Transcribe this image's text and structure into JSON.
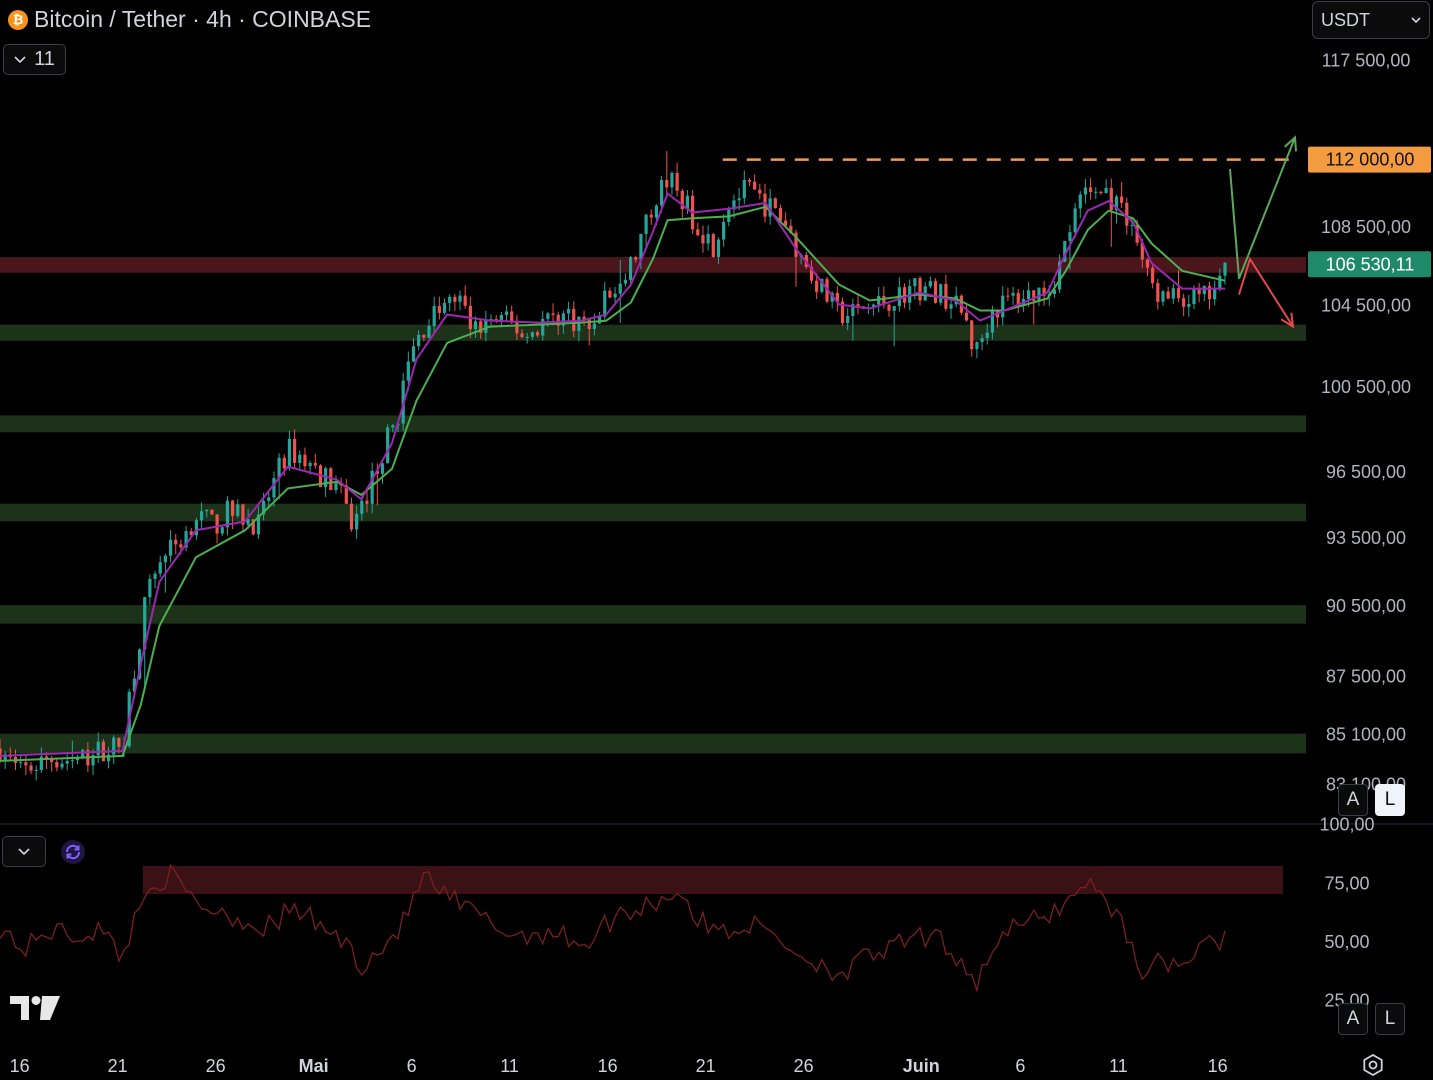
{
  "header": {
    "title": "Bitcoin / Tether · 4h · COINBASE",
    "coin_glyph": "₿",
    "indicators_count": "11"
  },
  "currency": {
    "selected": "USDT"
  },
  "scale_buttons": {
    "auto": "A",
    "log": "L"
  },
  "colors": {
    "up": "#26a69a",
    "down": "#ef5350",
    "ema_fast": "#9c27b0",
    "ema_slow": "#4caf50",
    "support_zone": "#1c3219",
    "resistance_zone": "#4a151b",
    "resistance_line": "#f59b3f",
    "rsi_line": "#7a1f22",
    "rsi_zone": "#3a1215",
    "last_price_bg": "#1f8a6a",
    "target_arrow": "#5aa95a",
    "drop_arrow": "#e04a4a"
  },
  "chart_data": [
    {
      "type": "candlestick",
      "title": "Bitcoin / Tether · 4h · COINBASE",
      "timeframe": "4h",
      "x_tick_labels": [
        "16",
        "21",
        "26",
        "Mai",
        "6",
        "11",
        "16",
        "21",
        "26",
        "Juin",
        "6",
        "11",
        "16"
      ],
      "y_tick_labels": [
        "117 500,00",
        "108 500,00",
        "104 500,00",
        "100 500,00",
        "96 500,00",
        "93 500,00",
        "90 500,00",
        "87 500,00",
        "85 100,00",
        "83 100,00"
      ],
      "y_range": [
        82600,
        118600
      ],
      "price_path": [
        [
          0,
          84500
        ],
        [
          1.6,
          83500
        ],
        [
          4,
          84100
        ],
        [
          6.5,
          84000
        ],
        [
          8.5,
          84500
        ],
        [
          10,
          84600
        ],
        [
          10.5,
          86500
        ],
        [
          11.2,
          88500
        ],
        [
          12,
          91000
        ],
        [
          13,
          92500
        ],
        [
          15,
          93500
        ],
        [
          16,
          94500
        ],
        [
          17.5,
          94000
        ],
        [
          18.6,
          94600
        ],
        [
          20,
          94400
        ],
        [
          21.2,
          94000
        ],
        [
          22,
          95500
        ],
        [
          23.5,
          97500
        ],
        [
          24.5,
          97200
        ],
        [
          26,
          96400
        ],
        [
          27.5,
          95800
        ],
        [
          28.8,
          94000
        ],
        [
          30,
          95500
        ],
        [
          31.5,
          97800
        ],
        [
          32.4,
          99000
        ],
        [
          33.5,
          102000
        ],
        [
          35,
          103800
        ],
        [
          36.5,
          104500
        ],
        [
          37.5,
          104800
        ],
        [
          38.6,
          103200
        ],
        [
          40,
          103700
        ],
        [
          41.5,
          103600
        ],
        [
          43,
          102900
        ],
        [
          44.5,
          103800
        ],
        [
          46,
          104000
        ],
        [
          47.5,
          103600
        ],
        [
          48.5,
          103200
        ],
        [
          49.2,
          104800
        ],
        [
          50,
          105000
        ],
        [
          50.8,
          105500
        ],
        [
          52,
          107200
        ],
        [
          53.2,
          109300
        ],
        [
          54,
          111200
        ],
        [
          55,
          110700
        ],
        [
          56.5,
          109000
        ],
        [
          58.2,
          107500
        ],
        [
          59.5,
          109800
        ],
        [
          61,
          110400
        ],
        [
          62.5,
          109600
        ],
        [
          64,
          108800
        ],
        [
          65.5,
          106800
        ],
        [
          67,
          105300
        ],
        [
          68.5,
          104000
        ],
        [
          70,
          104100
        ],
        [
          71,
          104400
        ],
        [
          73,
          104800
        ],
        [
          74.5,
          105400
        ],
        [
          76,
          105200
        ],
        [
          77.5,
          104800
        ],
        [
          78.8,
          103800
        ],
        [
          79.6,
          102000
        ],
        [
          81,
          104200
        ],
        [
          82.5,
          104800
        ],
        [
          84,
          105000
        ],
        [
          85.8,
          105400
        ],
        [
          86.5,
          106500
        ],
        [
          87.4,
          108500
        ],
        [
          88.5,
          110200
        ],
        [
          90.2,
          110300
        ],
        [
          91.5,
          109300
        ],
        [
          92.5,
          108400
        ],
        [
          93.7,
          105800
        ],
        [
          95,
          104700
        ],
        [
          96.5,
          104900
        ],
        [
          98,
          104700
        ],
        [
          99.5,
          105300
        ],
        [
          100,
          106200
        ]
      ],
      "ema_fast": [
        [
          0,
          84200
        ],
        [
          10,
          84400
        ],
        [
          11.5,
          88000
        ],
        [
          13,
          91500
        ],
        [
          16,
          93800
        ],
        [
          20,
          94200
        ],
        [
          23.5,
          96700
        ],
        [
          27.5,
          96100
        ],
        [
          29.5,
          95200
        ],
        [
          32,
          97800
        ],
        [
          34,
          101800
        ],
        [
          36.5,
          104000
        ],
        [
          40,
          103700
        ],
        [
          44,
          103600
        ],
        [
          47.5,
          103700
        ],
        [
          49.5,
          104000
        ],
        [
          51.5,
          105500
        ],
        [
          53.3,
          108200
        ],
        [
          54.5,
          110200
        ],
        [
          56.5,
          109200
        ],
        [
          59.5,
          109400
        ],
        [
          62.5,
          109700
        ],
        [
          65,
          107300
        ],
        [
          68.5,
          104500
        ],
        [
          71,
          104300
        ],
        [
          75,
          105100
        ],
        [
          78,
          104700
        ],
        [
          80,
          103700
        ],
        [
          82,
          104200
        ],
        [
          85.5,
          105100
        ],
        [
          87,
          107100
        ],
        [
          88.8,
          109300
        ],
        [
          90.5,
          109800
        ],
        [
          92.5,
          108700
        ],
        [
          94,
          106600
        ],
        [
          96.5,
          105300
        ],
        [
          100,
          105300
        ]
      ],
      "ema_slow": [
        [
          0,
          84000
        ],
        [
          10,
          84200
        ],
        [
          11.5,
          86300
        ],
        [
          13,
          89600
        ],
        [
          16,
          92600
        ],
        [
          20,
          93800
        ],
        [
          23.5,
          95700
        ],
        [
          27.5,
          96000
        ],
        [
          29.5,
          95400
        ],
        [
          32,
          96600
        ],
        [
          34,
          99800
        ],
        [
          36.5,
          102600
        ],
        [
          40,
          103400
        ],
        [
          44,
          103500
        ],
        [
          47.5,
          103600
        ],
        [
          49.5,
          103700
        ],
        [
          51.5,
          104600
        ],
        [
          53.3,
          106800
        ],
        [
          54.5,
          108800
        ],
        [
          56.5,
          108900
        ],
        [
          59.5,
          109000
        ],
        [
          62.5,
          109500
        ],
        [
          65,
          107900
        ],
        [
          68.5,
          105500
        ],
        [
          71,
          104700
        ],
        [
          75,
          105000
        ],
        [
          78,
          104800
        ],
        [
          80,
          104200
        ],
        [
          82,
          104200
        ],
        [
          85.5,
          104800
        ],
        [
          87,
          106200
        ],
        [
          88.8,
          108300
        ],
        [
          90.5,
          109300
        ],
        [
          92.5,
          108900
        ],
        [
          94,
          107600
        ],
        [
          96.5,
          106200
        ],
        [
          100,
          105700
        ]
      ],
      "support_zones": [
        [
          102700,
          103500
        ],
        [
          98300,
          99100
        ],
        [
          94200,
          95000
        ],
        [
          89700,
          90500
        ],
        [
          84300,
          85100
        ]
      ],
      "resistance_zones": [
        [
          106100,
          106900
        ]
      ],
      "resistance_level": 112000,
      "annotations": [
        {
          "label": "112 000,00",
          "value": 112000,
          "kind": "resistance"
        },
        {
          "label": "106 530,11",
          "value": 106530.11,
          "kind": "last_price"
        }
      ],
      "scenarios": [
        {
          "direction": "up",
          "from": 105800,
          "to": 113200
        },
        {
          "direction": "down",
          "from": 106200,
          "to": 103400
        }
      ]
    },
    {
      "type": "line",
      "indicator": "RSI",
      "y_tick_labels": [
        "100,00",
        "75,00",
        "50,00",
        "25,00"
      ],
      "y_range": [
        24,
        99
      ],
      "overbought_zone": [
        70,
        82
      ],
      "rsi_path": [
        [
          0,
          56
        ],
        [
          2,
          46
        ],
        [
          4,
          55
        ],
        [
          6,
          52
        ],
        [
          8,
          55
        ],
        [
          10,
          44
        ],
        [
          11.5,
          66
        ],
        [
          12.5,
          75
        ],
        [
          13.8,
          78
        ],
        [
          16,
          66
        ],
        [
          18.5,
          62
        ],
        [
          20,
          58
        ],
        [
          22,
          56
        ],
        [
          24,
          64
        ],
        [
          26,
          57
        ],
        [
          28,
          50
        ],
        [
          29.5,
          40
        ],
        [
          31,
          46
        ],
        [
          33,
          58
        ],
        [
          34.5,
          78
        ],
        [
          36,
          70
        ],
        [
          38,
          64
        ],
        [
          40,
          58
        ],
        [
          42,
          52
        ],
        [
          44,
          54
        ],
        [
          46,
          52
        ],
        [
          48,
          49
        ],
        [
          50,
          60
        ],
        [
          52,
          64
        ],
        [
          54,
          68
        ],
        [
          55.5,
          72
        ],
        [
          57,
          58
        ],
        [
          59,
          54
        ],
        [
          61,
          57
        ],
        [
          63,
          54
        ],
        [
          65,
          45
        ],
        [
          67,
          40
        ],
        [
          69,
          36
        ],
        [
          71,
          44
        ],
        [
          73,
          47
        ],
        [
          75,
          52
        ],
        [
          77,
          49
        ],
        [
          78.5,
          42
        ],
        [
          79.8,
          32
        ],
        [
          81,
          48
        ],
        [
          83,
          56
        ],
        [
          85,
          60
        ],
        [
          87,
          66
        ],
        [
          88.5,
          76
        ],
        [
          90,
          69
        ],
        [
          91.5,
          60
        ],
        [
          92.5,
          45
        ],
        [
          93.5,
          36
        ],
        [
          95,
          42
        ],
        [
          96.5,
          40
        ],
        [
          98,
          46
        ],
        [
          100,
          52
        ]
      ]
    }
  ]
}
